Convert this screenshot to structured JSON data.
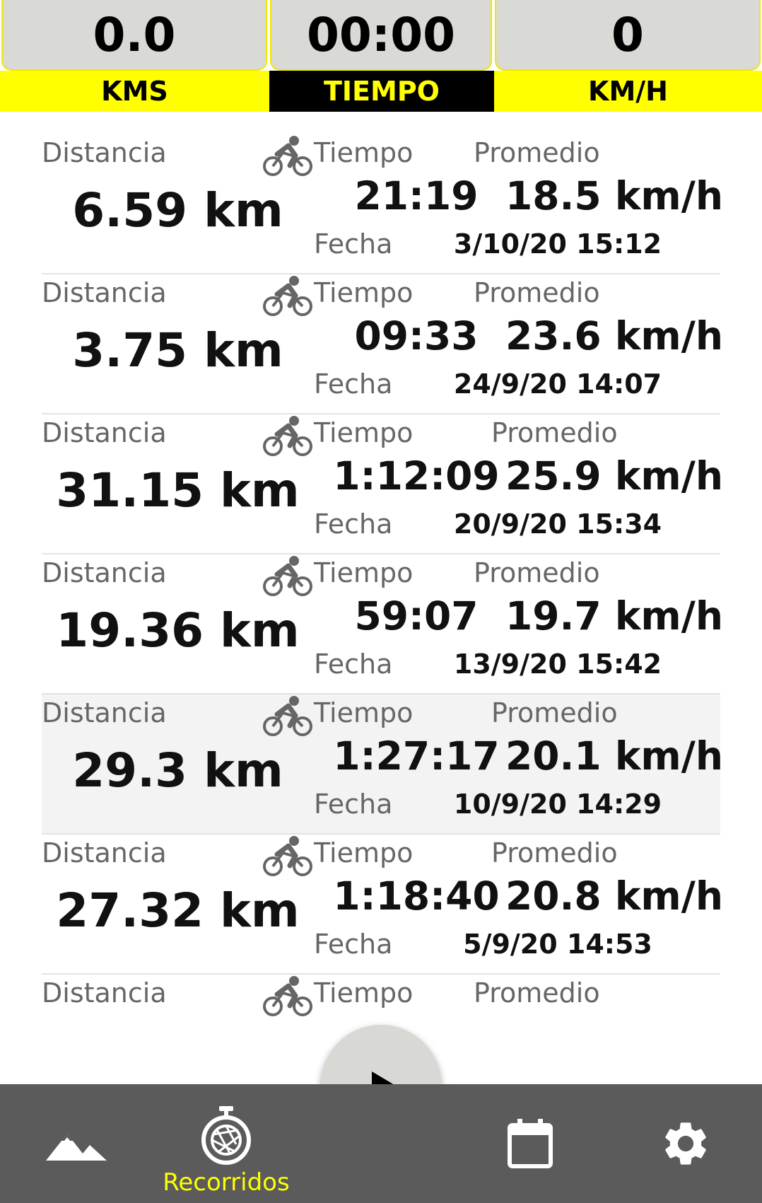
{
  "stats": [
    {
      "value": "0.0",
      "label": "KMS"
    },
    {
      "value": "00:00",
      "label": "TIEMPO"
    },
    {
      "value": "0",
      "label": "KM/H"
    }
  ],
  "labels": {
    "distance": "Distancia",
    "time": "Tiempo",
    "average": "Promedio",
    "date": "Fecha"
  },
  "rides": [
    {
      "distance": "6.59 km",
      "time": "21:19",
      "average": "18.5 km/h",
      "date": "3/10/20 15:12"
    },
    {
      "distance": "3.75 km",
      "time": "09:33",
      "average": "23.6 km/h",
      "date": "24/9/20 14:07"
    },
    {
      "distance": "31.15 km",
      "time": "1:12:09",
      "average": "25.9 km/h",
      "date": "20/9/20 15:34"
    },
    {
      "distance": "19.36 km",
      "time": "59:07",
      "average": "19.7 km/h",
      "date": "13/9/20 15:42"
    },
    {
      "distance": "29.3 km",
      "time": "1:27:17",
      "average": "20.1 km/h",
      "date": "10/9/20 14:29"
    },
    {
      "distance": "27.32 km",
      "time": "1:18:40",
      "average": "20.8 km/h",
      "date": "5/9/20 14:53"
    }
  ],
  "partial_ride": {
    "visible": true
  },
  "nav": {
    "items": [
      {
        "icon": "mountain-icon",
        "label": ""
      },
      {
        "icon": "stopwatch-shutter-icon",
        "label": "Recorridos",
        "active": true
      },
      {
        "icon": "calendar-icon",
        "label": ""
      },
      {
        "icon": "gear-icon",
        "label": ""
      }
    ],
    "play_icon": "play-icon"
  },
  "colors": {
    "accent": "#ffff00",
    "bar": "#5b5b5b",
    "stat_box": "#d9d9d6"
  }
}
